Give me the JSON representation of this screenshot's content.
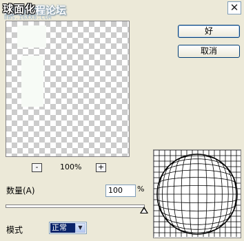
{
  "window": {
    "title": "球面化",
    "close_icon": "close-icon"
  },
  "watermark": {
    "main": "思缘教程论坛",
    "sub": "BBS.16XX8.COM"
  },
  "buttons": {
    "ok_label": "好",
    "cancel_label": "取消"
  },
  "preview": {
    "zoom_level": "100%",
    "zoom_out_label": "-",
    "zoom_in_label": "+"
  },
  "amount": {
    "label": "数量(A)",
    "value": "100",
    "unit": "%",
    "slider_fraction": 1.0
  },
  "mode": {
    "label": "模式",
    "selected": "正常"
  }
}
